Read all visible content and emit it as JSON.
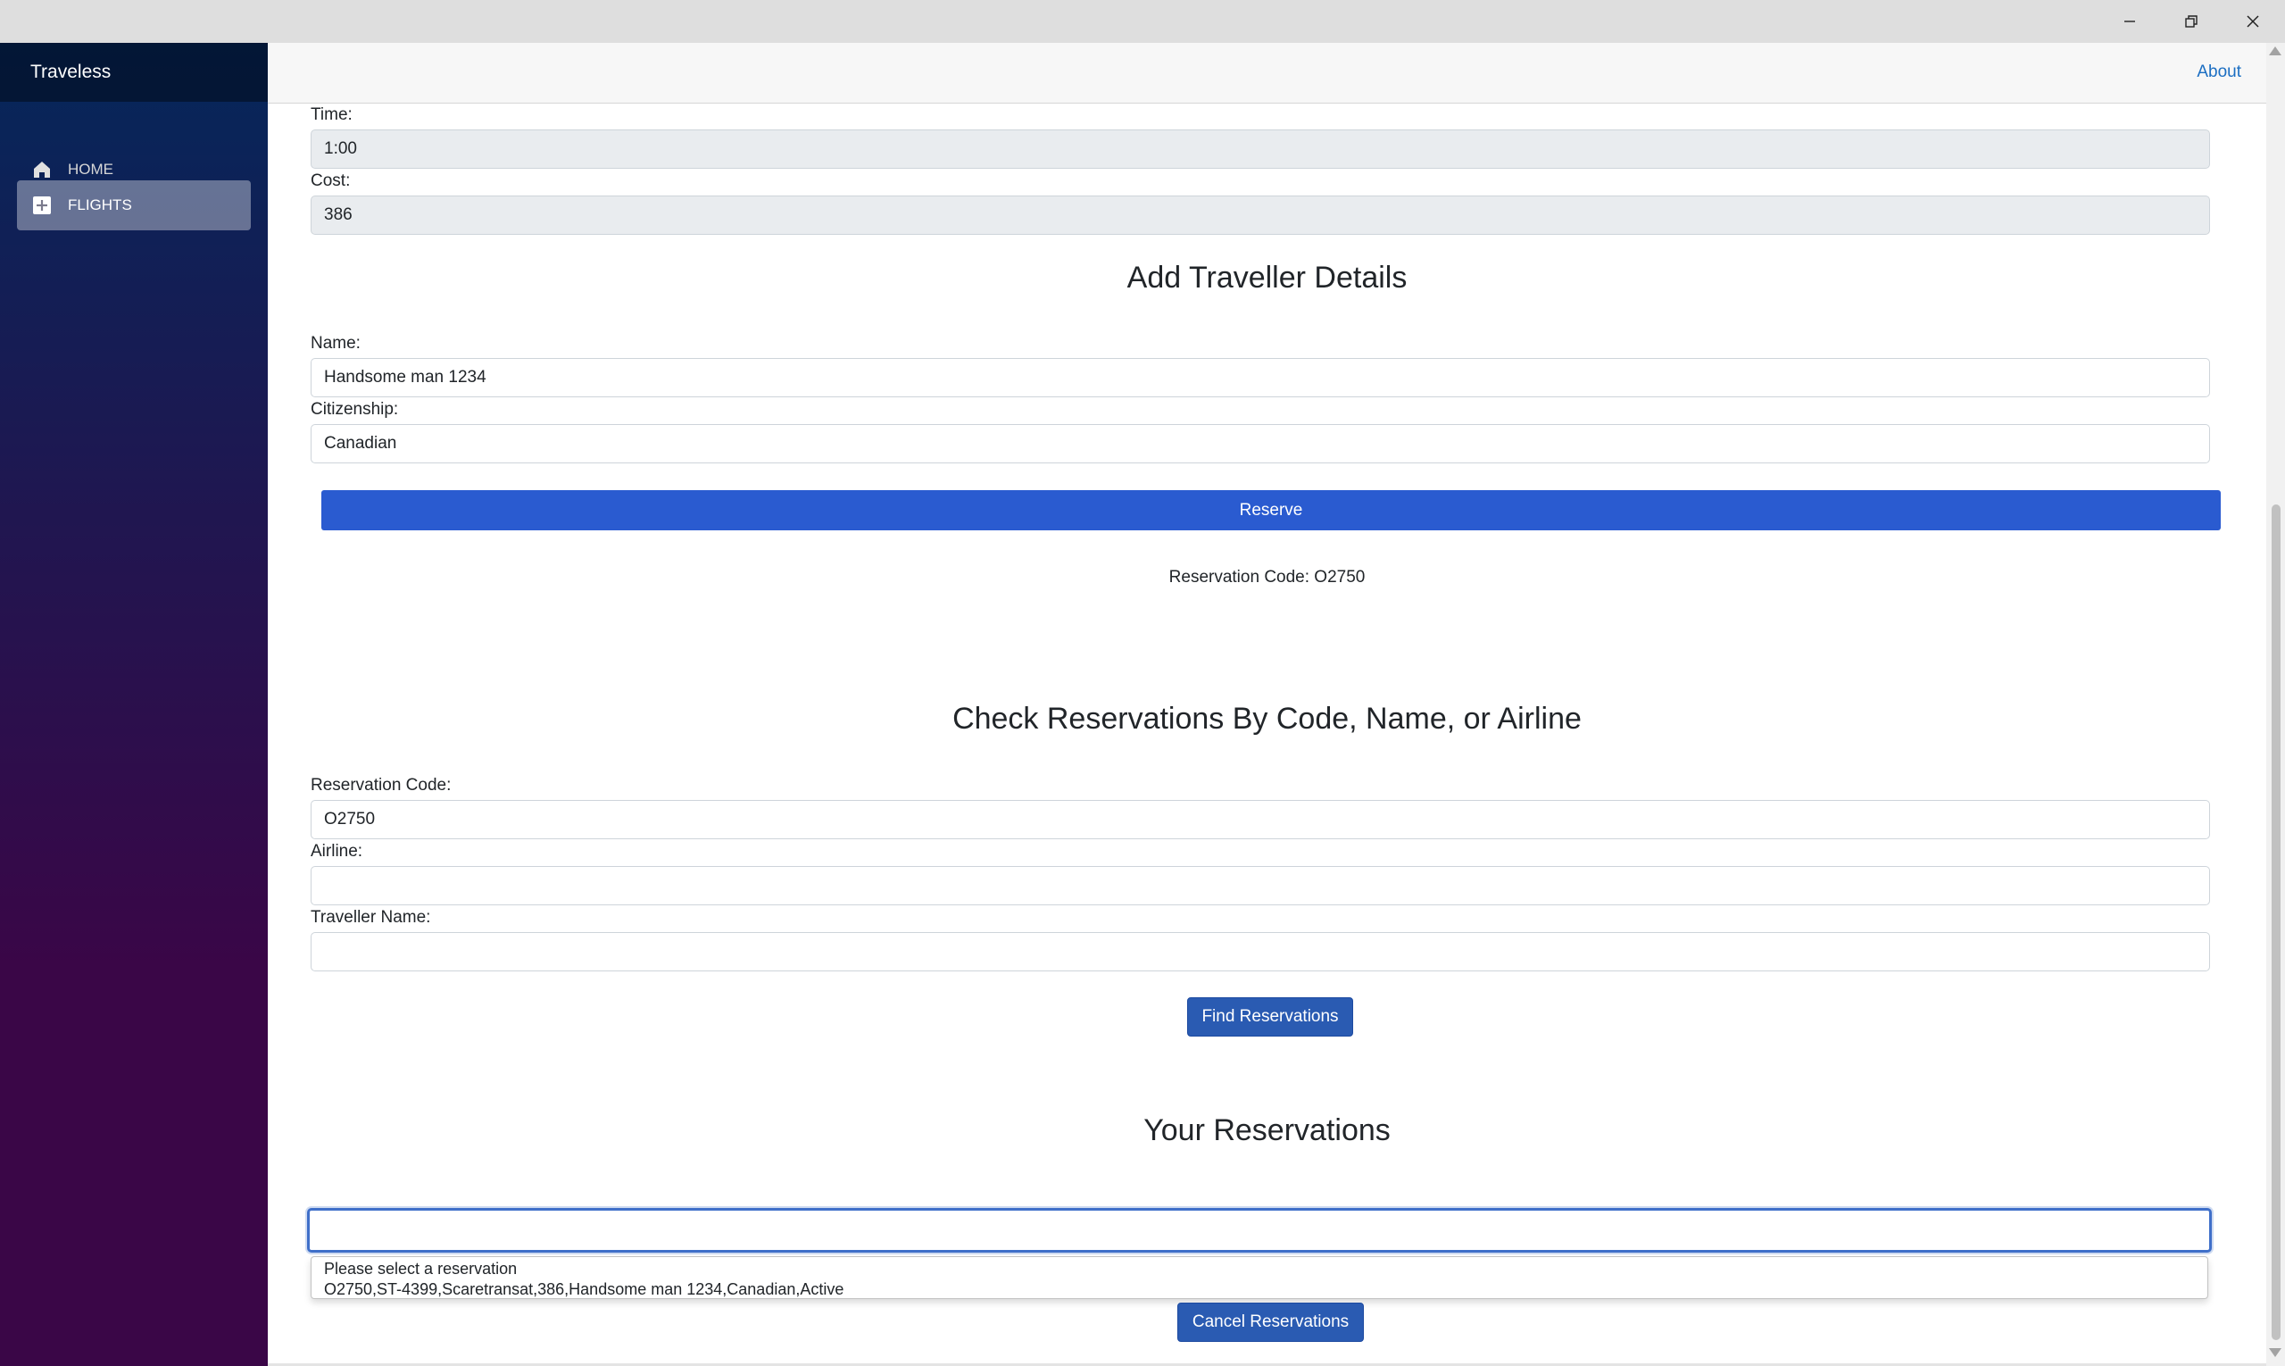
{
  "window": {
    "minimize_icon": "minimize-icon",
    "maximize_icon": "restore-icon",
    "close_icon": "close-icon"
  },
  "sidebar": {
    "brand": "Traveless",
    "items": [
      {
        "label": "HOME",
        "icon": "home-icon",
        "active": false
      },
      {
        "label": "FLIGHTS",
        "icon": "plus-square-icon",
        "active": true
      }
    ]
  },
  "header": {
    "about_label": "About"
  },
  "flight": {
    "time_label": "Time:",
    "time_value": "1:00",
    "cost_label": "Cost:",
    "cost_value": "386"
  },
  "traveller": {
    "heading": "Add Traveller Details",
    "name_label": "Name:",
    "name_value": "Handsome man 1234",
    "citizenship_label": "Citizenship:",
    "citizenship_value": "Canadian",
    "reserve_label": "Reserve",
    "reservation_code_text": "Reservation Code: O2750"
  },
  "search": {
    "heading": "Check Reservations By Code, Name, or Airline",
    "code_label": "Reservation Code:",
    "code_value": "O2750",
    "airline_label": "Airline:",
    "airline_value": "",
    "traveller_label": "Traveller Name:",
    "traveller_value": "",
    "find_label": "Find Reservations"
  },
  "reservations": {
    "heading": "Your Reservations",
    "selected_value": "",
    "options": [
      "Please select a reservation",
      "O2750,ST-4399,Scaretransat,386,Handsome man 1234,Canadian,Active"
    ],
    "cancel_label": "Cancel Reservations"
  },
  "colors": {
    "primary_button": "#2a5bd0",
    "secondary_button": "#2a5bb2",
    "link": "#1b6ec2",
    "sidebar_top": "#05275a",
    "sidebar_bottom": "#3a0647"
  }
}
